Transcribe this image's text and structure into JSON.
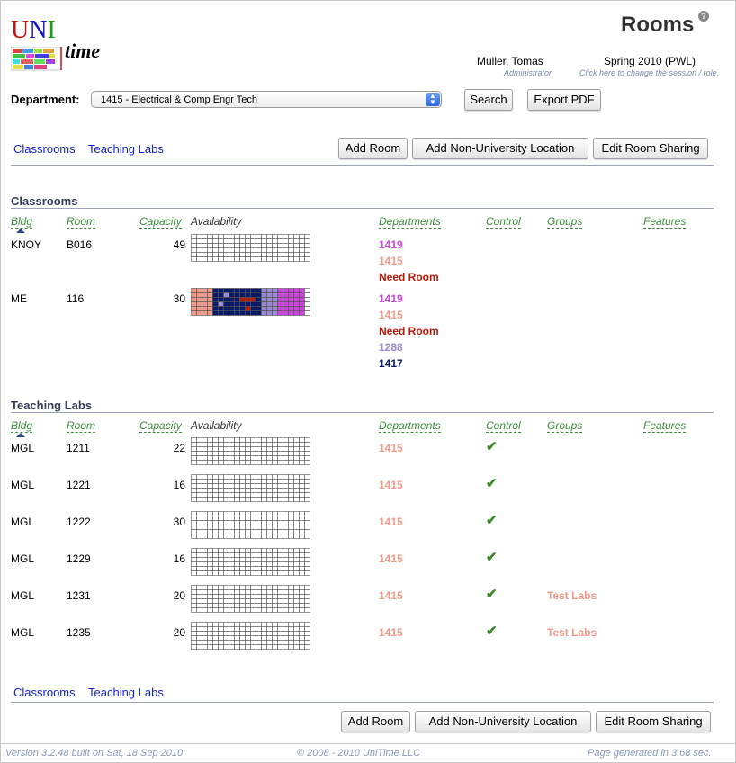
{
  "colors": {
    "d1419": "#cc44dd",
    "d1415": "#f29a8a",
    "need": "#b81a0a",
    "d1288": "#9a88d0",
    "d1417": "#0a1a6a",
    "link": "#1424c8",
    "colhead": "#3c8c3c"
  },
  "logo": {
    "uni": "UNI",
    "time": "time"
  },
  "header": {
    "title": "Rooms",
    "help": "?",
    "user": "Muller, Tomas",
    "role": "Administrator",
    "session": "Spring 2010 (PWL)",
    "session_hint": "Click here to change the session / role."
  },
  "filter": {
    "label": "Department:",
    "selected": "1415 - Electrical & Comp Engr Tech",
    "search": "Search",
    "export": "Export PDF"
  },
  "nav": {
    "classrooms": "Classrooms",
    "labs": "Teaching Labs"
  },
  "actions": {
    "add_room": "Add Room",
    "add_nonuniv": "Add Non-University Location",
    "edit_sharing": "Edit Room Sharing"
  },
  "columns": {
    "bldg": "Bldg",
    "room": "Room",
    "capacity": "Capacity",
    "availability": "Availability",
    "departments": "Departments",
    "control": "Control",
    "groups": "Groups",
    "features": "Features"
  },
  "classrooms": {
    "title": "Classrooms",
    "rows": [
      {
        "bldg": "KNOY",
        "room": "B016",
        "capacity": "49",
        "departments": [
          {
            "name": "1419",
            "color": "d1419"
          },
          {
            "name": "1415",
            "color": "d1415"
          },
          {
            "name": "Need Room",
            "color": "need"
          }
        ],
        "control": false,
        "group": ""
      },
      {
        "bldg": "ME",
        "room": "116",
        "capacity": "30",
        "departments": [
          {
            "name": "1419",
            "color": "d1419"
          },
          {
            "name": "1415",
            "color": "d1415"
          },
          {
            "name": "Need Room",
            "color": "need"
          },
          {
            "name": "1288",
            "color": "d1288"
          },
          {
            "name": "1417",
            "color": "d1417"
          }
        ],
        "control": false,
        "group": ""
      }
    ]
  },
  "labs": {
    "title": "Teaching Labs",
    "rows": [
      {
        "bldg": "MGL",
        "room": "1211",
        "capacity": "22",
        "departments": [
          {
            "name": "1415",
            "color": "d1415"
          }
        ],
        "control": true,
        "group": ""
      },
      {
        "bldg": "MGL",
        "room": "1221",
        "capacity": "16",
        "departments": [
          {
            "name": "1415",
            "color": "d1415"
          }
        ],
        "control": true,
        "group": ""
      },
      {
        "bldg": "MGL",
        "room": "1222",
        "capacity": "30",
        "departments": [
          {
            "name": "1415",
            "color": "d1415"
          }
        ],
        "control": true,
        "group": ""
      },
      {
        "bldg": "MGL",
        "room": "1229",
        "capacity": "16",
        "departments": [
          {
            "name": "1415",
            "color": "d1415"
          }
        ],
        "control": true,
        "group": ""
      },
      {
        "bldg": "MGL",
        "room": "1231",
        "capacity": "20",
        "departments": [
          {
            "name": "1415",
            "color": "d1415"
          }
        ],
        "control": true,
        "group": "Test Labs"
      },
      {
        "bldg": "MGL",
        "room": "1235",
        "capacity": "20",
        "departments": [
          {
            "name": "1415",
            "color": "d1415"
          }
        ],
        "control": true,
        "group": "Test Labs"
      }
    ]
  },
  "footer": {
    "version": "Version 3.2.48 built on Sat, 18 Sep 2010",
    "copyright": "© 2008 - 2010 UniTime LLC",
    "generated": "Page generated in 3.68 sec."
  }
}
